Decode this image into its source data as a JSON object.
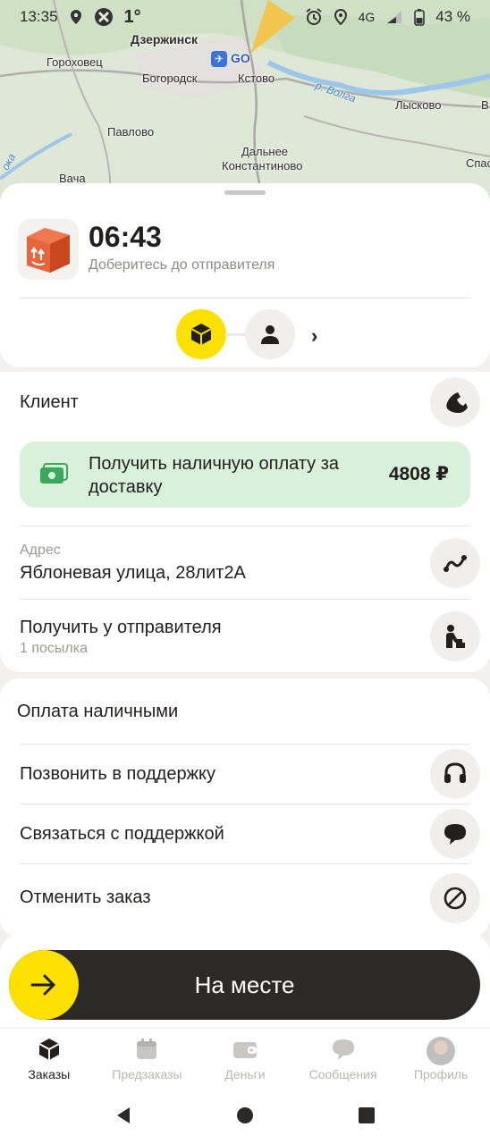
{
  "status_bar": {
    "time": "13:35",
    "temperature": "1°",
    "network": "4G",
    "battery": "43 %"
  },
  "map": {
    "labels": [
      "Дзержинск",
      "Гороховец",
      "Богородск",
      "Кстово",
      "Павлово",
      "Дальнее",
      "Константиново",
      "Вача",
      "Лысково",
      "р. Волга",
      "ока",
      "GO",
      "Спас",
      "В"
    ]
  },
  "order": {
    "timer": "06:43",
    "timer_subtitle": "Доберитесь до отправителя"
  },
  "client": {
    "title": "Клиент",
    "payment_text": "Получить наличную оплату за доставку",
    "payment_amount": "4808 ₽",
    "address_label": "Адрес",
    "address_value": "Яблоневая улица, 28лит2А",
    "pickup_title": "Получить у отправителя",
    "pickup_subtitle": "1 посылка"
  },
  "menu": {
    "payment_method": "Оплата наличными",
    "call_support": "Позвонить в поддержку",
    "contact_support": "Связаться с поддержкой",
    "cancel_order": "Отменить заказ"
  },
  "action": {
    "label": "На месте"
  },
  "tabs": [
    {
      "label": "Заказы",
      "icon": "box-icon",
      "active": true
    },
    {
      "label": "Предзаказы",
      "icon": "calendar-icon",
      "active": false
    },
    {
      "label": "Деньги",
      "icon": "wallet-icon",
      "active": false
    },
    {
      "label": "Сообщения",
      "icon": "chat-icon",
      "active": false
    },
    {
      "label": "Профиль",
      "icon": "avatar",
      "active": false
    }
  ],
  "colors": {
    "accent": "#fce000",
    "payment_bg": "#d9f0da",
    "payment_icon": "#3aa85a",
    "dark": "#2b2a29"
  }
}
